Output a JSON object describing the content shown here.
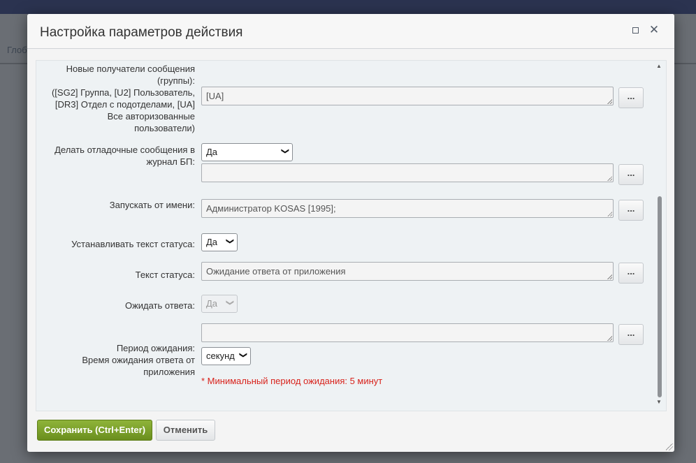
{
  "background": {
    "partial_text": "Глоб"
  },
  "dialog": {
    "title": "Настройка параметров действия",
    "maximize_icon": "square-icon",
    "close_glyph": "✕"
  },
  "form": {
    "recipients": {
      "label_lines": [
        "Новые получатели сообщения",
        "(группы):",
        "([SG2] Группа, [U2] Пользователь,",
        "[DR3] Отдел с подотделами, [UA]",
        "Все авторизованные",
        "пользователи)"
      ],
      "value": "[UA]",
      "button": "..."
    },
    "debug": {
      "label_lines": [
        "Делать отладочные сообщения в",
        "журнал БП:"
      ],
      "selected": "Да",
      "value": "",
      "button": "..."
    },
    "run_as": {
      "label": "Запускать от имени:",
      "value": "Администратор KOSAS [1995];",
      "button": "..."
    },
    "set_status": {
      "label": "Устанавливать текст статуса:",
      "selected": "Да"
    },
    "status_text": {
      "label": "Текст статуса:",
      "value": "Ожидание ответа от приложения",
      "button": "..."
    },
    "wait_reply": {
      "label": "Ожидать ответа:",
      "selected": "Да"
    },
    "wait_period": {
      "label_lines": [
        "Период ожидания:",
        "Время ожидания ответа от",
        "приложения"
      ],
      "value": "",
      "button": "...",
      "unit_selected": "секунд",
      "hint": "* Минимальный период ожидания: 5 минут"
    }
  },
  "footer": {
    "save_label": "Сохранить (Ctrl+Enter)",
    "cancel_label": "Отменить"
  },
  "colors": {
    "save_green": "#7ba12c",
    "hint_red": "#d8231c",
    "header_bg": "#f7f7f7"
  }
}
